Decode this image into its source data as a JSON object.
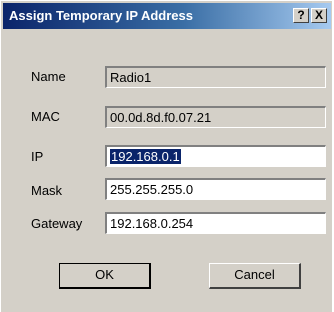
{
  "window": {
    "title": "Assign Temporary IP Address",
    "help_glyph": "?",
    "close_glyph": "X"
  },
  "form": {
    "name": {
      "label": "Name",
      "value": "Radio1"
    },
    "mac": {
      "label": "MAC",
      "value": "00.0d.8d.f0.07.21"
    },
    "ip": {
      "label": "IP",
      "value": "192.168.0.1"
    },
    "mask": {
      "label": "Mask",
      "value": "255.255.255.0"
    },
    "gateway": {
      "label": "Gateway",
      "value": "192.168.0.254"
    }
  },
  "buttons": {
    "ok": "OK",
    "cancel": "Cancel"
  },
  "colors": {
    "title_start": "#0a246a",
    "title_end": "#a6caf0",
    "dialog_face": "#d4d0c8",
    "selection": "#0a246a"
  }
}
